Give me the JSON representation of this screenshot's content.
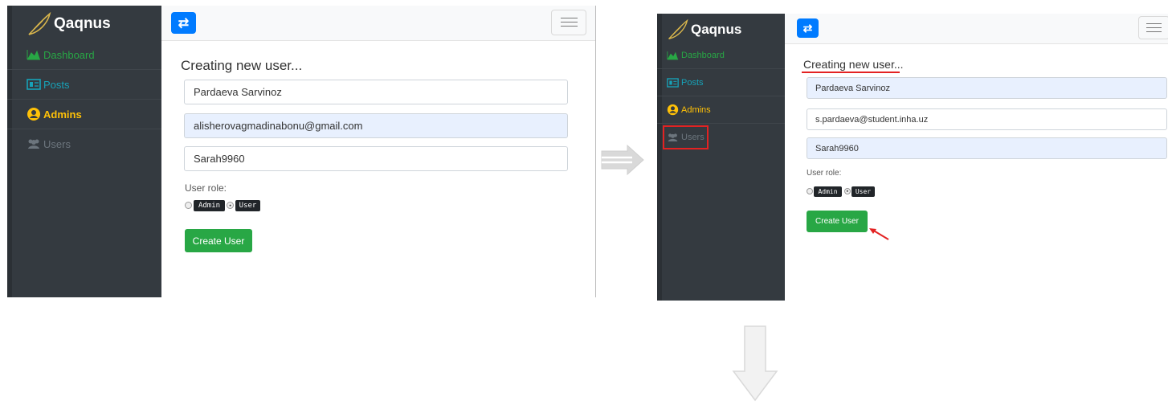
{
  "colors": {
    "sidebar_bg": "#343a40",
    "dashboard": "#28a745",
    "posts": "#17a2b8",
    "admins": "#ffc107",
    "users": "#6c757d",
    "primary": "#007bff",
    "success": "#28a745",
    "annotation": "#e32222",
    "arrow": "#d9d9d9"
  },
  "left": {
    "brand": "Qaqnus",
    "nav": {
      "dashboard": "Dashboard",
      "posts": "Posts",
      "admins": "Admins",
      "users": "Users"
    },
    "toggle_icon": "⇄",
    "heading": "Creating new user...",
    "name_value": "Pardaeva Sarvinoz",
    "email_value": "alisherovagmadinabonu@gmail.com",
    "password_value": "Sarah9960",
    "role_label": "User role:",
    "role_admin": "Admin",
    "role_user": "User",
    "submit_label": "Create User"
  },
  "right": {
    "brand": "Qaqnus",
    "nav": {
      "dashboard": "Dashboard",
      "posts": "Posts",
      "admins": "Admins",
      "users": "Users"
    },
    "toggle_icon": "⇄",
    "heading": "Creating new user...",
    "name_value": "Pardaeva Sarvinoz",
    "email_value": "s.pardaeva@student.inha.uz",
    "password_value": "Sarah9960",
    "role_label": "User role:",
    "role_admin": "Admin",
    "role_user": "User",
    "submit_label": "Create User"
  }
}
